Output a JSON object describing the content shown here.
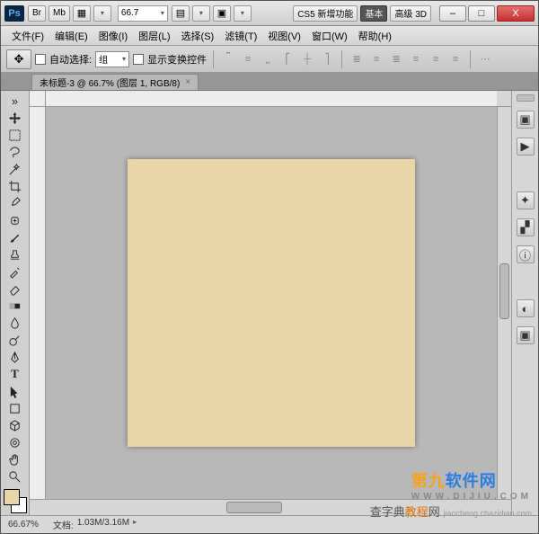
{
  "titlebar": {
    "ps": "Ps",
    "br": "Br",
    "mb": "Mb",
    "zoom": "66.7",
    "cs5_new": "CS5 新增功能",
    "basic": "基本",
    "adv3d": "高级 3D"
  },
  "winbtns": {
    "min": "–",
    "max": "□",
    "close": "X"
  },
  "menu": {
    "file": "文件(F)",
    "edit": "编辑(E)",
    "image": "图像(I)",
    "layer": "图层(L)",
    "select": "选择(S)",
    "filter": "滤镜(T)",
    "view": "视图(V)",
    "window": "窗口(W)",
    "help": "帮助(H)"
  },
  "options": {
    "auto_select_label": "自动选择:",
    "group_value": "组",
    "show_transform_label": "显示变换控件"
  },
  "doc_tab": {
    "title": "未标题-3 @ 66.7% (图层 1, RGB/8)",
    "close": "×"
  },
  "status": {
    "zoom": "66.67%",
    "doc_label": "文档:",
    "doc_value": "1.03M/3.16M"
  },
  "chart_data": {
    "type": "table",
    "note": "solid fill canvas, no chart"
  },
  "wm": {
    "big_a": "第九",
    "big_b": "软件网",
    "sub": "WWW.DIJIU.COM",
    "small_pre": "查字典",
    "small_hl": "教程",
    "small_post": "网",
    "small_url": "jiaocheng.chazidian.com"
  }
}
